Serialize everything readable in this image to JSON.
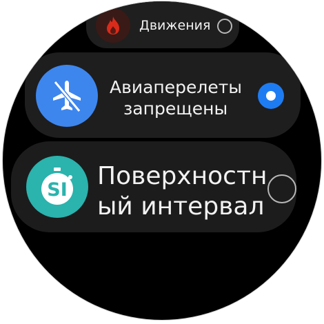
{
  "items": [
    {
      "label": "Движения",
      "icon": "flame-icon",
      "icon_color": "#d92b1b",
      "icon_bg": "#3a1a16",
      "selected": false
    },
    {
      "label_line1": "Авиаперелеты",
      "label_line2": "запрещены",
      "icon": "no-flight-icon",
      "icon_bg": "#3d86ee",
      "selected": true
    },
    {
      "label_line1": "Поверхностн",
      "label_line2": "ый интервал",
      "icon": "surface-interval-icon",
      "icon_text": "SI",
      "icon_bg": "#2bb3ad",
      "selected": false
    }
  ],
  "colors": {
    "accent": "#1e7cf2",
    "card_bg": "#1e1e1e",
    "text": "#f2f2f2"
  }
}
